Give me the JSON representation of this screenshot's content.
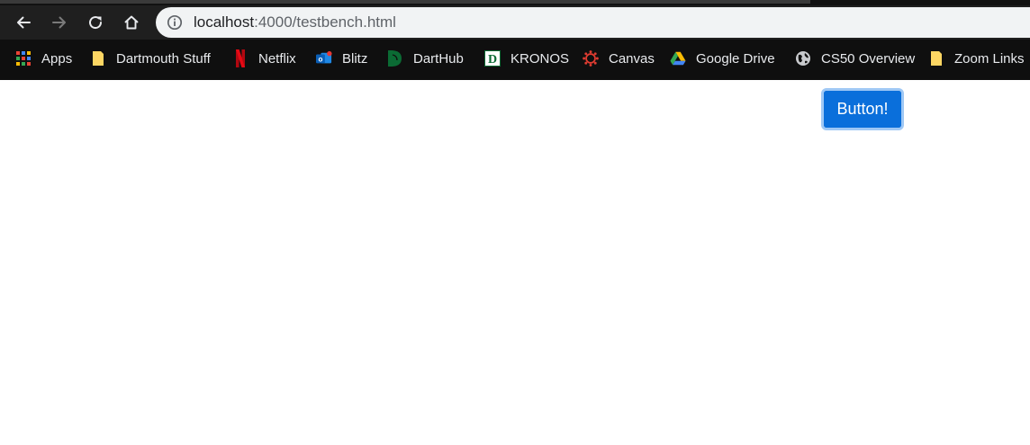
{
  "toolbar": {
    "back_icon": "arrow-left-icon",
    "forward_icon": "arrow-right-icon",
    "reload_icon": "reload-icon",
    "home_icon": "home-icon"
  },
  "address_bar": {
    "host": "localhost",
    "path": ":4000/testbench.html",
    "info_icon": "info-icon"
  },
  "bookmarks": [
    {
      "label": "Apps",
      "icon": "apps-grid-icon"
    },
    {
      "label": "Dartmouth Stuff",
      "icon": "folder-icon"
    },
    {
      "label": "Netflix",
      "icon": "netflix-icon"
    },
    {
      "label": "Blitz",
      "icon": "outlook-icon"
    },
    {
      "label": "DartHub",
      "icon": "darthub-icon"
    },
    {
      "label": "KRONOS",
      "icon": "kronos-icon"
    },
    {
      "label": "Canvas",
      "icon": "canvas-icon"
    },
    {
      "label": "Google Drive",
      "icon": "google-drive-icon"
    },
    {
      "label": "CS50 Overview",
      "icon": "globe-icon"
    },
    {
      "label": "Zoom Links",
      "icon": "folder-icon"
    }
  ],
  "page": {
    "button_label": "Button!"
  },
  "colors": {
    "chrome_background": "#1f1f1f",
    "bookmark_bar": "#0f0f0f",
    "omnibox": "#f1f3f4",
    "button_fill": "#0a6fdb",
    "button_focus_ring": "#9fc8f5"
  }
}
